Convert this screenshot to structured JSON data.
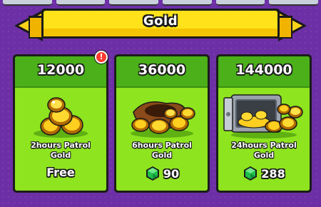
{
  "header": {
    "title": "Gold"
  },
  "offers": [
    {
      "amount": "12000",
      "desc_line1": "2hours Patrol",
      "desc_line2": "Gold",
      "price": "Free",
      "art": "gold-coin-pile-icon"
    },
    {
      "amount": "36000",
      "desc_line1": "6hours Patrol",
      "desc_line2": "Gold",
      "price": "90",
      "art": "gold-sack-icon"
    },
    {
      "amount": "144000",
      "desc_line1": "24hours Patrol",
      "desc_line2": "Gold",
      "price": "288",
      "art": "gold-safe-icon"
    }
  ],
  "badge": {
    "label": "!"
  },
  "colors": {
    "background": "#6d2fa6",
    "banner": "#ffe21a",
    "card_green": "#8ee41e",
    "card_header": "#4bb01a",
    "gem": "#1fbf4a"
  }
}
